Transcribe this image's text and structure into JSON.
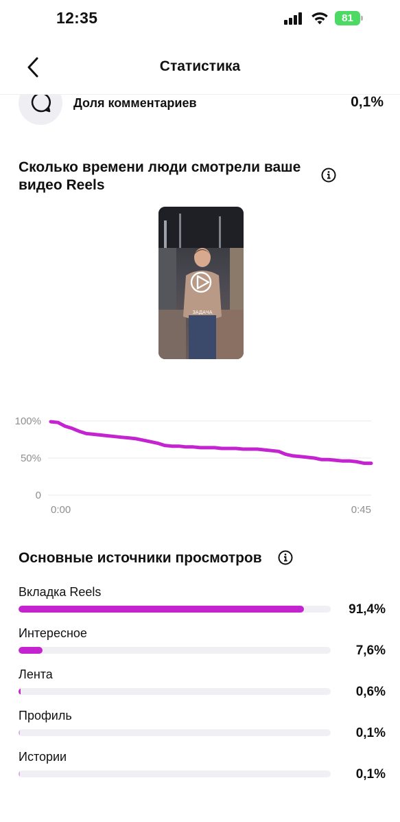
{
  "status": {
    "time": "12:35",
    "battery": "81"
  },
  "nav": {
    "title": "Статистика"
  },
  "metric": {
    "label": "Доля комментариев",
    "value": "0,1%"
  },
  "watch_section": {
    "title_line1": "Сколько времени люди смотрели ваше",
    "title_line2": "видео Reels"
  },
  "thumbnail": {
    "caption": "ЗАДАЧА"
  },
  "chart_data": {
    "type": "line",
    "x": [
      0,
      1,
      2,
      3,
      4,
      5,
      6,
      7,
      8,
      9,
      10,
      11,
      12,
      13,
      14,
      15,
      16,
      17,
      18,
      19,
      20,
      21,
      22,
      23,
      24,
      25,
      26,
      27,
      28,
      29,
      30,
      31,
      32,
      33,
      34,
      35,
      36,
      37,
      38,
      39,
      40,
      41,
      42,
      43,
      44,
      45
    ],
    "values": [
      99,
      98,
      93,
      90,
      86,
      83,
      82,
      81,
      80,
      79,
      78,
      77,
      76,
      74,
      72,
      70,
      67,
      66,
      66,
      65,
      65,
      64,
      64,
      64,
      63,
      63,
      63,
      62,
      62,
      62,
      61,
      60,
      59,
      55,
      53,
      52,
      51,
      50,
      48,
      48,
      47,
      46,
      46,
      45,
      43,
      43
    ],
    "ylim": [
      0,
      100
    ],
    "y_ticks": [
      "0",
      "50%",
      "100%"
    ],
    "x_ticks": [
      "0:00",
      "0:45"
    ],
    "color": "#c424d0",
    "grid": true
  },
  "sources": {
    "title": "Основные источники просмотров",
    "items": [
      {
        "label": "Вкладка Reels",
        "value": "91,4%",
        "fraction": 0.914
      },
      {
        "label": "Интересное",
        "value": "7,6%",
        "fraction": 0.076
      },
      {
        "label": "Лента",
        "value": "0,6%",
        "fraction": 0.006
      },
      {
        "label": "Профиль",
        "value": "0,1%",
        "fraction": 0.001
      },
      {
        "label": "Истории",
        "value": "0,1%",
        "fraction": 0.001
      }
    ]
  },
  "colors": {
    "accent": "#c424d0",
    "track": "#efeff4",
    "battery": "#4cd964"
  }
}
